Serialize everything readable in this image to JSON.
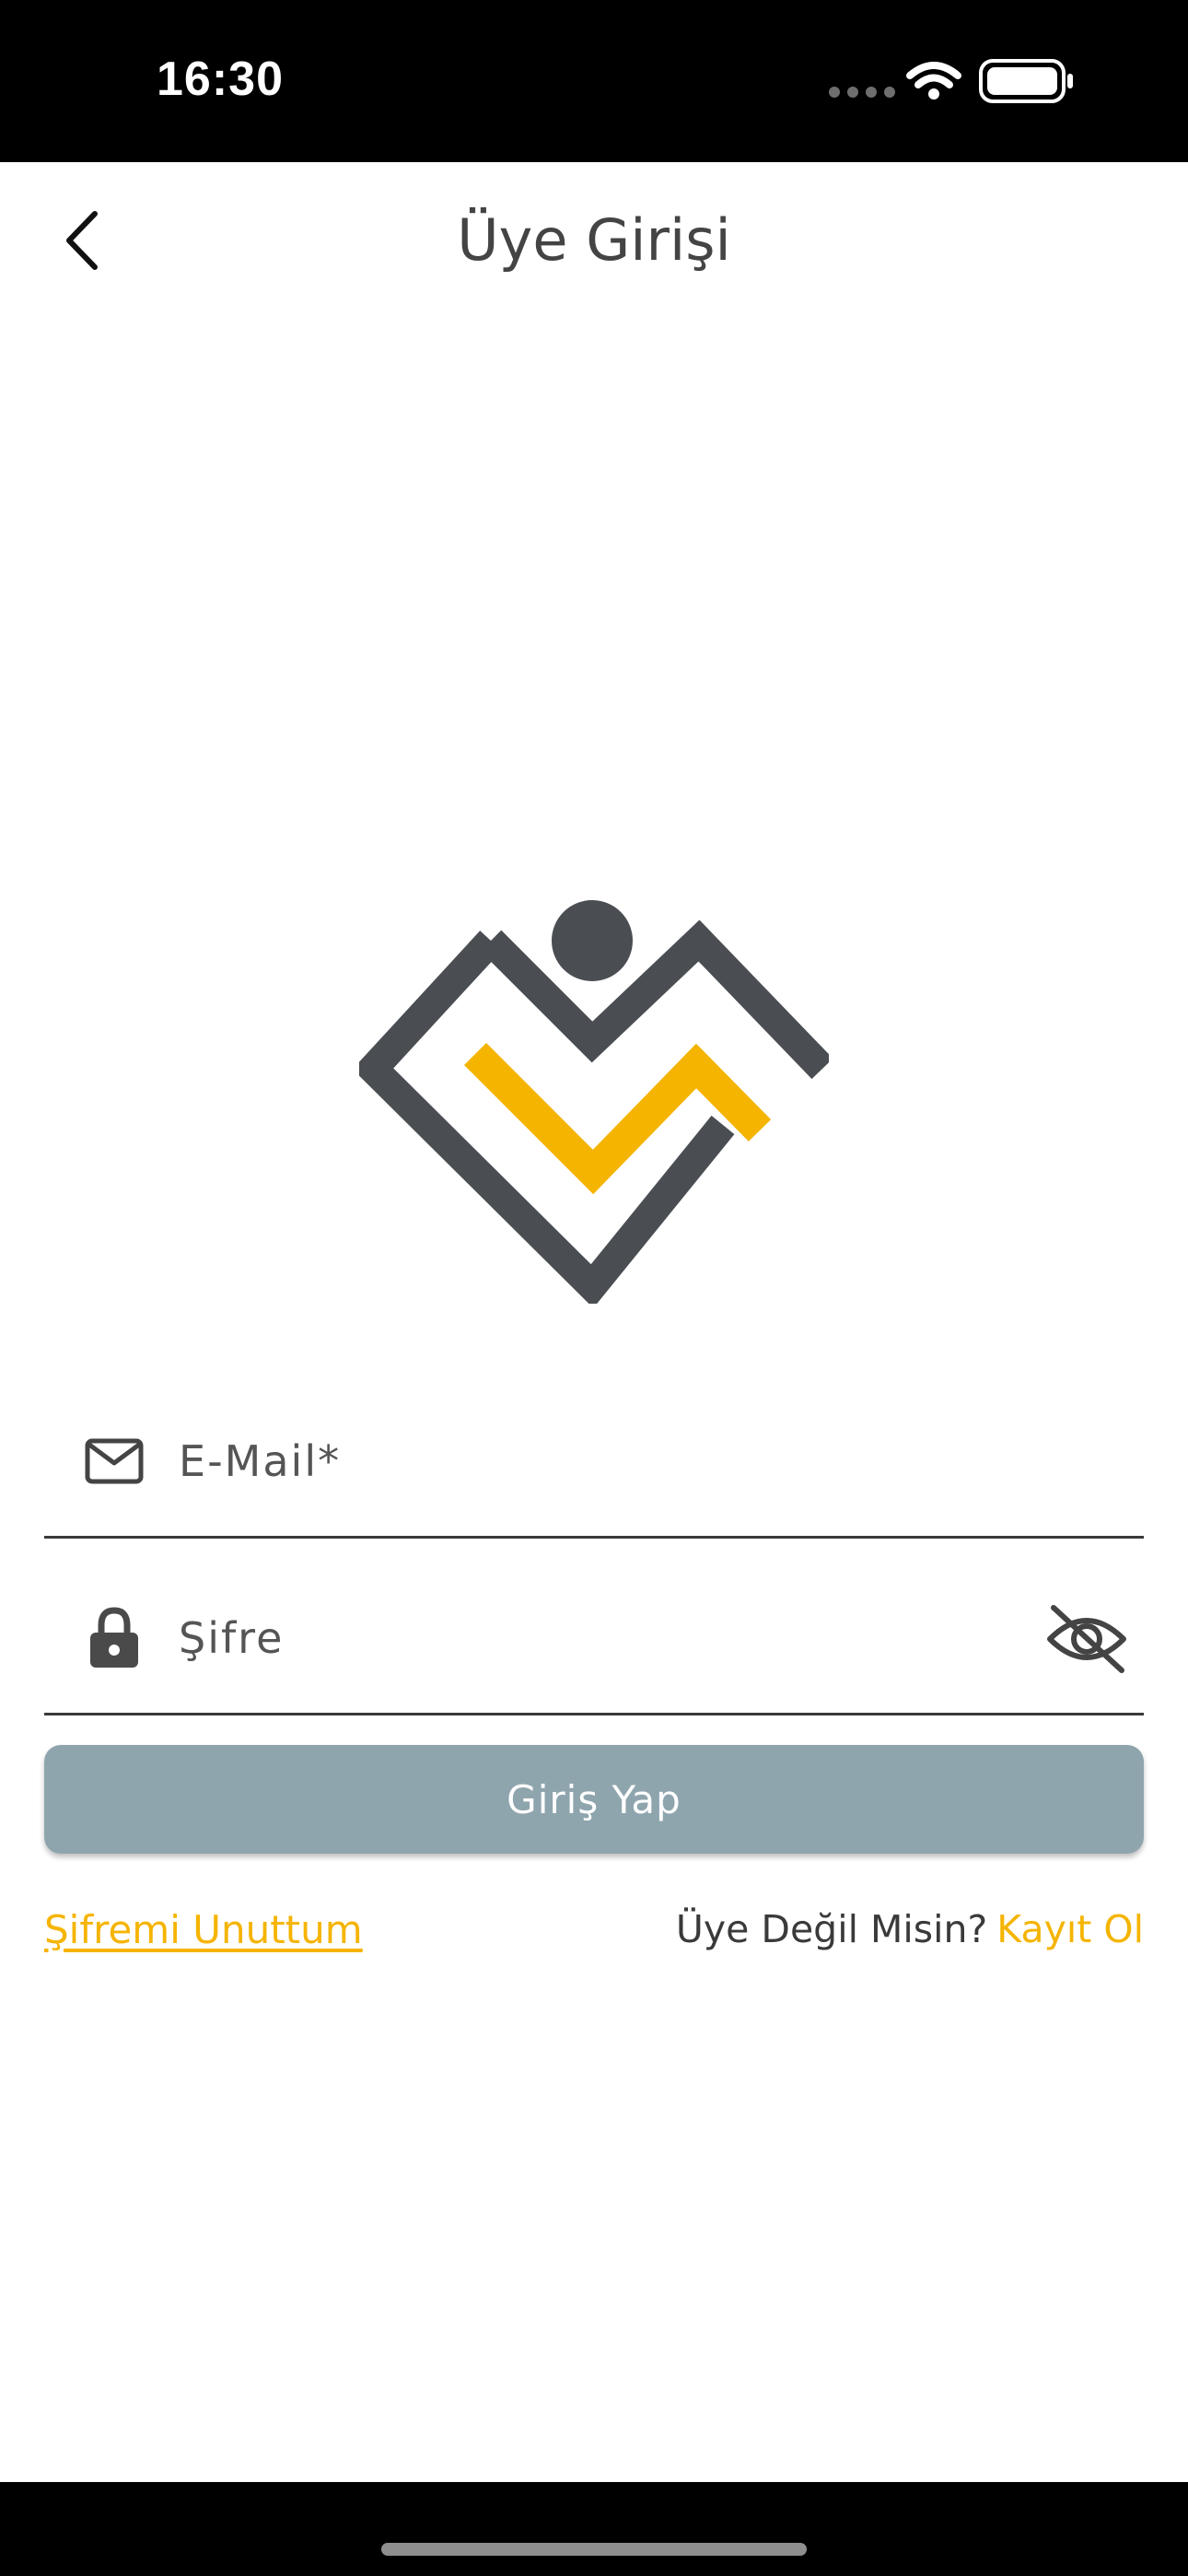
{
  "status_bar": {
    "time": "16:30",
    "icons": [
      "signal-dots-icon",
      "wifi-icon",
      "battery-icon"
    ]
  },
  "header": {
    "title": "Üye Girişi",
    "back_icon": "chevron-left-icon"
  },
  "form": {
    "email": {
      "placeholder": "E-Mail*",
      "value": "",
      "icon": "mail-icon"
    },
    "password": {
      "placeholder": "Şifre",
      "value": "",
      "icon": "lock-icon",
      "toggle_icon": "eye-off-icon"
    },
    "submit_label": "Giriş Yap"
  },
  "links": {
    "forgot_password": "Şifremi Unuttum",
    "register_prompt": "Üye Değil Misin?",
    "register_label": "Kayıt Ol"
  },
  "colors": {
    "accent": "#f5b400",
    "logo_gray": "#4a4e53",
    "button_disabled": "#8fa5ae",
    "status_bar": "#000000"
  }
}
